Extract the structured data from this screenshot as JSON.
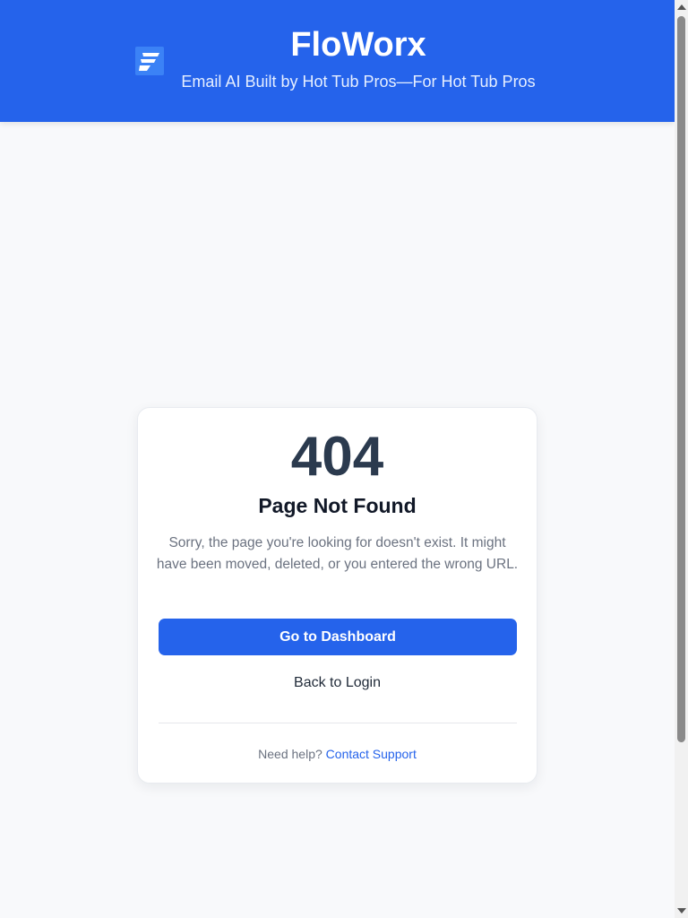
{
  "header": {
    "brand_title": "FloWorx",
    "tagline": "Email AI Built by Hot Tub Pros—For Hot Tub Pros",
    "logo_icon": "floworx-logo-icon",
    "bg_color": "#2563eb"
  },
  "error_card": {
    "code": "404",
    "heading": "Page Not Found",
    "description": "Sorry, the page you're looking for doesn't exist. It might have been moved, deleted, or you entered the wrong URL.",
    "primary_button_label": "Go to Dashboard",
    "secondary_link_label": "Back to Login",
    "help_text": "Need help?",
    "help_link_label": "Contact Support"
  },
  "colors": {
    "accent": "#2563eb",
    "code_text": "#2b3a4e",
    "muted_text": "#6b7280",
    "page_bg": "#f8f9fb"
  }
}
